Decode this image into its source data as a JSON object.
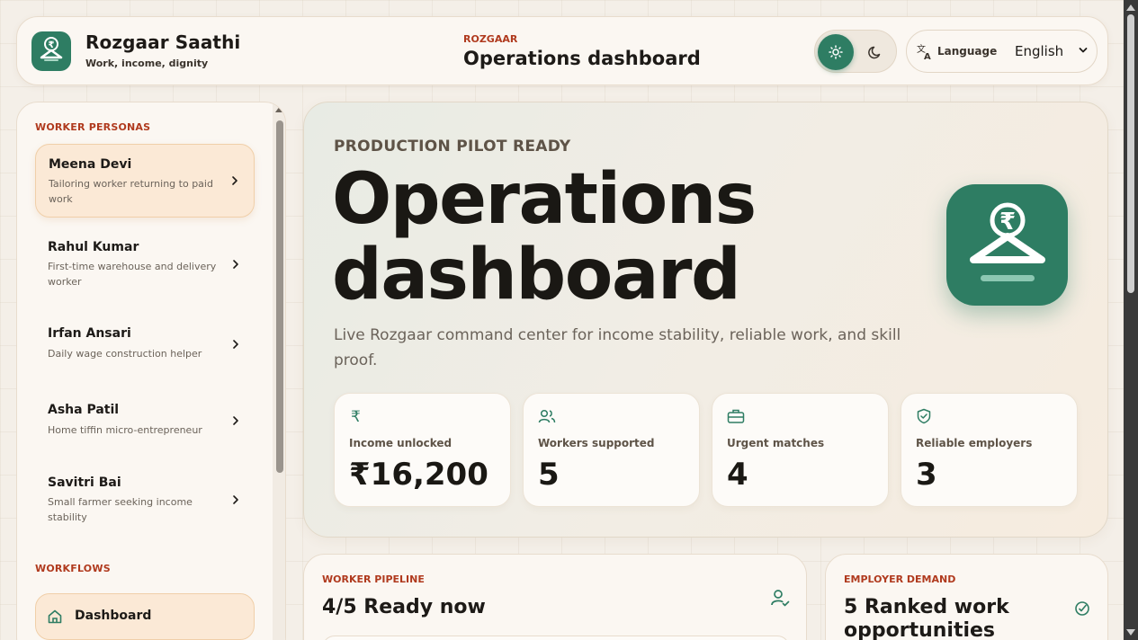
{
  "brand": {
    "name": "Rozgaar Saathi",
    "tagline": "Work, income, dignity"
  },
  "header": {
    "eyebrow": "ROZGAAR",
    "title": "Operations dashboard",
    "theme": {
      "active": "light"
    },
    "language": {
      "label": "Language",
      "value": "English"
    }
  },
  "sidebar": {
    "personas_heading": "WORKER PERSONAS",
    "personas": [
      {
        "name": "Meena Devi",
        "desc": "Tailoring worker returning to paid work",
        "active": true
      },
      {
        "name": "Rahul Kumar",
        "desc": "First-time warehouse and delivery worker",
        "active": false
      },
      {
        "name": "Irfan Ansari",
        "desc": "Daily wage construction helper",
        "active": false
      },
      {
        "name": "Asha Patil",
        "desc": "Home tiffin micro-entrepreneur",
        "active": false
      },
      {
        "name": "Savitri Bai",
        "desc": "Small farmer seeking income stability",
        "active": false
      }
    ],
    "workflows_heading": "WORKFLOWS",
    "workflows": [
      {
        "label": "Dashboard",
        "icon": "home-icon",
        "active": true
      }
    ]
  },
  "hero": {
    "eyebrow": "PRODUCTION PILOT READY",
    "title_line1": "Operations",
    "title_line2": "dashboard",
    "description": "Live Rozgaar command center for income stability, reliable work, and skill proof.",
    "stats": [
      {
        "icon": "rupee-icon",
        "label": "Income unlocked",
        "value": "₹16,200"
      },
      {
        "icon": "users-icon",
        "label": "Workers supported",
        "value": "5"
      },
      {
        "icon": "briefcase-icon",
        "label": "Urgent matches",
        "value": "4"
      },
      {
        "icon": "shield-check-icon",
        "label": "Reliable employers",
        "value": "3"
      }
    ]
  },
  "cards": {
    "pipeline": {
      "eyebrow": "WORKER PIPELINE",
      "title": "4/5 Ready now",
      "icon": "user-check-icon"
    },
    "demand": {
      "eyebrow": "EMPLOYER DEMAND",
      "title_line1": "5 Ranked work",
      "title_line2": "opportunities",
      "icon": "target-check-icon"
    }
  },
  "colors": {
    "accent": "#2e7d63",
    "eyebrow": "#b03a1e",
    "active_bg": "#fbe9d6"
  }
}
